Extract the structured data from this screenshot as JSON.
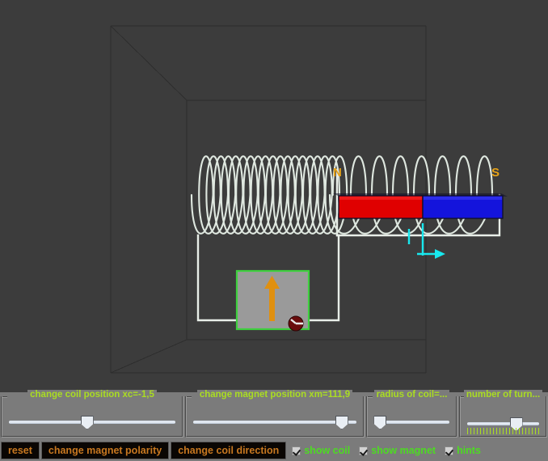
{
  "scene": {
    "background_color": "#3c3c3c",
    "box_line_color": "#2a2a2a",
    "coil_color": "#dfe8e0",
    "wire_color": "#e6ece6",
    "magnet": {
      "north_label": "N",
      "south_label": "S",
      "north_color": "#e00000",
      "south_color": "#1414dc",
      "pole_label_color": "#e8a317",
      "outline_color": "#10102a"
    },
    "current": {
      "label": "I",
      "color": "#18e8ee"
    },
    "meter": {
      "face_color": "#9a9a9a",
      "border_color": "#3ecf3e",
      "needle_color": "#e09010",
      "pivot_color": "#6a0d0d"
    }
  },
  "controls": {
    "sliders": [
      {
        "name": "change-coil-position",
        "title": "change coil position xc=-1,5",
        "value_percent": 47,
        "ticks": 0
      },
      {
        "name": "change-magnet-position",
        "title": "change magnet position xm=111,9",
        "value_percent": 91,
        "ticks": 0
      },
      {
        "name": "radius-of-coil",
        "title": "radius of coil=...",
        "value_percent": 8,
        "ticks": 0
      },
      {
        "name": "number-of-turns",
        "title": "number of turn...",
        "value_percent": 68,
        "ticks": 23
      }
    ],
    "buttons": [
      {
        "name": "reset-button",
        "label": "reset"
      },
      {
        "name": "change-magnet-polarity-button",
        "label": "change magnet polarity"
      },
      {
        "name": "change-coil-direction-button",
        "label": "change coil direction"
      }
    ],
    "checkboxes": [
      {
        "name": "show-coil-checkbox",
        "label": "show coil",
        "checked": true
      },
      {
        "name": "show-magnet-checkbox",
        "label": "show magnet",
        "checked": true
      },
      {
        "name": "hints-checkbox",
        "label": "hints",
        "checked": true
      }
    ]
  }
}
